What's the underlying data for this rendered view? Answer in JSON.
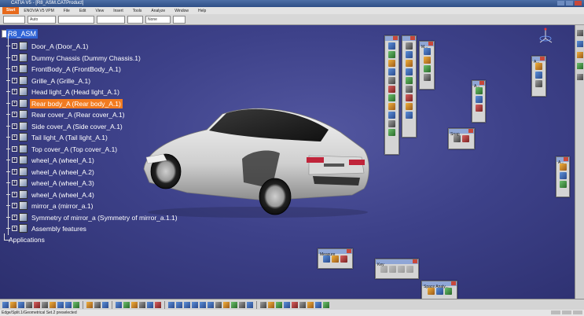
{
  "window": {
    "title": "CATIA V5 - [R8_ASM.CATProduct]"
  },
  "menu": {
    "start": "Start",
    "items": [
      "ENOVIA V5 VPM",
      "File",
      "Edit",
      "View",
      "Insert",
      "Tools",
      "Analyze",
      "Window",
      "Help"
    ]
  },
  "properties_bar": {
    "color": "",
    "transparency": "Auto",
    "linetype": "",
    "thickness": "",
    "layer": "None"
  },
  "tree": {
    "root": "R8_ASM",
    "items": [
      {
        "label": "Door_A (Door_A.1)",
        "selected": false
      },
      {
        "label": "Dummy Chassis (Dummy Chassis.1)",
        "selected": false
      },
      {
        "label": "FrontBody_A (FrontBody_A.1)",
        "selected": false
      },
      {
        "label": "Grille_A (Grille_A.1)",
        "selected": false
      },
      {
        "label": "Head light_A (Head light_A.1)",
        "selected": false
      },
      {
        "label": "Rear body_A (Rear body_A.1)",
        "selected": true
      },
      {
        "label": "Rear cover_A (Rear cover_A.1)",
        "selected": false
      },
      {
        "label": "Side cover_A (Side cover_A.1)",
        "selected": false
      },
      {
        "label": "Tail light_A (Tail light_A.1)",
        "selected": false
      },
      {
        "label": "Top cover_A (Top cover_A.1)",
        "selected": false
      },
      {
        "label": "wheel_A (wheel_A.1)",
        "selected": false
      },
      {
        "label": "wheel_A (wheel_A.2)",
        "selected": false
      },
      {
        "label": "wheel_A (wheel_A.3)",
        "selected": false
      },
      {
        "label": "wheel_A (wheel_A.4)",
        "selected": false
      },
      {
        "label": "mirror_a (mirror_a.1)",
        "selected": false
      },
      {
        "label": "Symmetry of mirror_a (Symmetry of mirror_a.1.1)",
        "selected": false
      },
      {
        "label": "Assembly features",
        "selected": false
      }
    ],
    "applications": "Applications"
  },
  "toolboxes": {
    "snap": "Snap",
    "measure": "Measure",
    "key": "Key",
    "space_analysis": "Space Analy...",
    "a1": "A...",
    "a2": "A...",
    "a3": "A...",
    "a4": "A...",
    "m1": "M..."
  },
  "statusbar": {
    "text": "Edge/Split.1/Geometrical Set.2 preselected"
  },
  "colors": {
    "selection": "#f27b20",
    "root_highlight": "#2f63d5",
    "background": "#3d4189"
  }
}
